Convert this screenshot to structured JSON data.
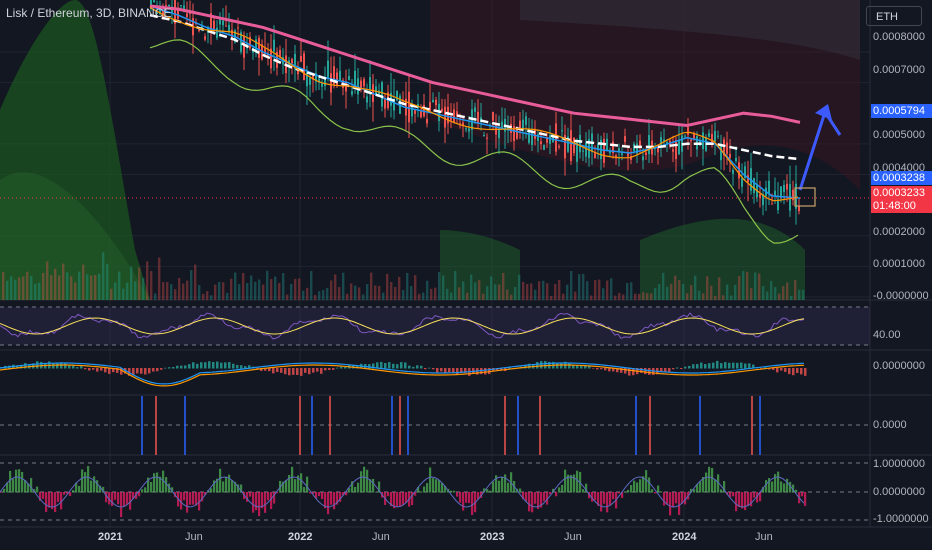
{
  "header": {
    "symbol_title": "Lisk / Ethereum, 3D, BINANCE",
    "currency": "ETH"
  },
  "colors": {
    "background": "#131722",
    "axis_text": "#b2b5be",
    "blue_tag": "#2962ff",
    "red_tag": "#f23645",
    "rsi": "#7e57c2",
    "rsi_signal": "#f7e05a",
    "macd": "#2196f3",
    "macd_signal": "#ff9800",
    "green_zone": "#1b5e20",
    "ema_white": "#ffffff",
    "ema_pink": "#e85c9a",
    "forecast_arrow": "#3d5afe"
  },
  "price_axis": {
    "labels": [
      "0.0008000",
      "0.0007000",
      "0.0005000",
      "0.0004000",
      "0.0002000",
      "0.0001000",
      "-0.0000000"
    ]
  },
  "price_tags": {
    "target": "0.0005794",
    "last_blue": "0.0003238",
    "last_red": "0.0003233",
    "countdown": "01:48:00"
  },
  "rsi_pane": {
    "level_label": "40.00"
  },
  "macd_pane": {
    "zero_label": "0.0000000"
  },
  "signal_pane": {
    "zero_label": "0.0000"
  },
  "osc_pane": {
    "labels": [
      "1.0000000",
      "0.0000000",
      "-1.0000000"
    ]
  },
  "time_axis": {
    "labels": [
      "2021",
      "Jun",
      "2022",
      "Jun",
      "2023",
      "Jun",
      "2024",
      "Jun"
    ],
    "year_labels": [
      "2021",
      "2022",
      "2023",
      "2024"
    ]
  },
  "chart_data": {
    "type": "line",
    "title": "Lisk / Ethereum, 3D, BINANCE",
    "x": [
      "2020-12",
      "2021-01",
      "2021-03",
      "2021-05",
      "2021-07",
      "2021-09",
      "2021-11",
      "2022-01",
      "2022-03",
      "2022-05",
      "2022-07",
      "2022-09",
      "2022-11",
      "2023-01",
      "2023-03",
      "2023-05",
      "2023-07",
      "2023-09",
      "2023-11",
      "2024-01",
      "2024-03",
      "2024-05",
      "2024-06",
      "2024-07"
    ],
    "series": [
      {
        "values": [
          0.00095,
          0.00092,
          0.00088,
          0.00085,
          0.0008,
          0.00076,
          0.00072,
          0.0007,
          0.00066,
          0.00062,
          0.0006,
          0.00058,
          0.00056,
          0.00054,
          0.00052,
          0.0005,
          0.00048,
          0.00047,
          0.00049,
          0.00052,
          0.0005,
          0.0004,
          0.00033,
          0.000323
        ]
      },
      {
        "values": [
          0.00092,
          0.0009,
          0.00087,
          0.00084,
          0.00079,
          0.00075,
          0.00072,
          0.00069,
          0.00066,
          0.00063,
          0.00061,
          0.00059,
          0.00057,
          0.00055,
          0.00053,
          0.00051,
          0.0005,
          0.00049,
          0.00049,
          0.0005,
          0.0005,
          0.00048,
          0.00046,
          0.00045
        ]
      },
      {
        "values": [
          0.00095,
          0.00094,
          0.00092,
          0.0009,
          0.00088,
          0.00085,
          0.00082,
          0.00079,
          0.00076,
          0.00073,
          0.0007,
          0.00068,
          0.00066,
          0.00064,
          0.00062,
          0.0006,
          0.00059,
          0.00058,
          0.00057,
          0.00056,
          0.00058,
          0.0006,
          0.00059,
          0.00057
        ]
      }
    ],
    "ylim": [
      0,
      0.00095
    ],
    "y_scale": "linear",
    "grid": true,
    "legend": "none"
  }
}
